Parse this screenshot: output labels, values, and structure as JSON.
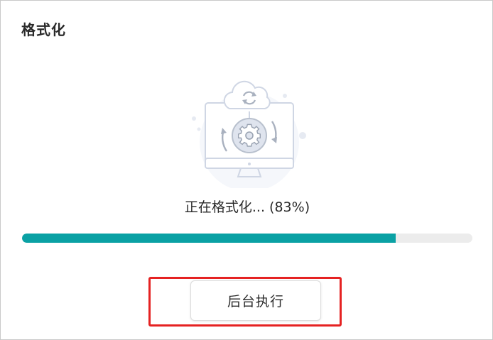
{
  "dialog": {
    "title": "格式化",
    "illustration_icon": "cloud-sync-monitor-gear-icon",
    "status_text": "正在格式化... (83%)",
    "progress": 0.83,
    "background_button_label": "后台执行"
  },
  "colors": {
    "progress_fill": "#0aa1a4",
    "progress_track": "#ececec",
    "highlight_border": "#e52222",
    "illustration_line": "#cfd6e4"
  }
}
